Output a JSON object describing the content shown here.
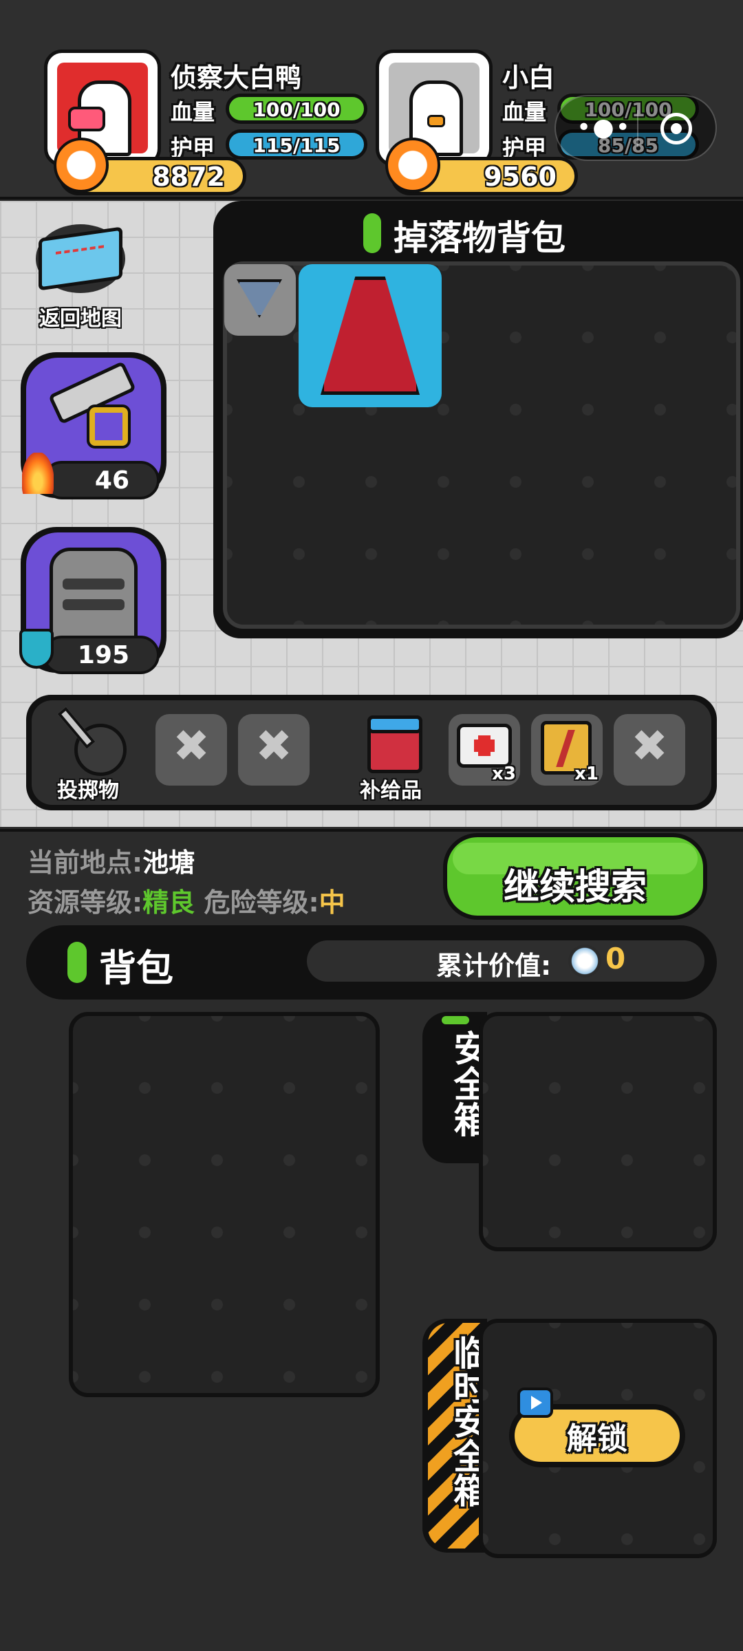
{
  "players": [
    {
      "name": "侦察大白鸭",
      "hp_label": "血量",
      "hp": "100/100",
      "armor_label": "护甲",
      "armor": "115/115",
      "power": "8872",
      "avatar_bg": "#e02d2d"
    },
    {
      "name": "小白",
      "hp_label": "血量",
      "hp": "100/100",
      "armor_label": "护甲",
      "armor": "85/85",
      "power": "9560",
      "avatar_bg": "#bdbdbd"
    }
  ],
  "left_panel": {
    "map_label": "返回地图",
    "weapon_value": "46",
    "armor_value": "195"
  },
  "loot": {
    "title": "掉落物背包",
    "items": [
      "rank-badge-icon",
      "red-cape-icon"
    ]
  },
  "consumables": {
    "throwables_label": "投掷物",
    "supplies_label": "补给品",
    "medkit_count": "x3",
    "energy_count": "x1"
  },
  "location": {
    "current_label": "当前地点:",
    "current_value": "池塘",
    "resource_label": "资源等级:",
    "resource_value": "精良",
    "danger_label": "危险等级:",
    "danger_value": "中"
  },
  "continue_button": "继续搜索",
  "backpack": {
    "title": "背包",
    "value_label": "累计价值:",
    "value": "0"
  },
  "safe_box": {
    "label": "安全箱"
  },
  "temp_safe_box": {
    "label": "临时安全箱",
    "unlock_button": "解锁"
  },
  "colors": {
    "hp_bar": "#5ec72d",
    "armor_bar": "#2fa7d8",
    "power_pill": "#f6c54a",
    "resource_green": "#5ec72d",
    "danger_yellow": "#f6c54a"
  }
}
